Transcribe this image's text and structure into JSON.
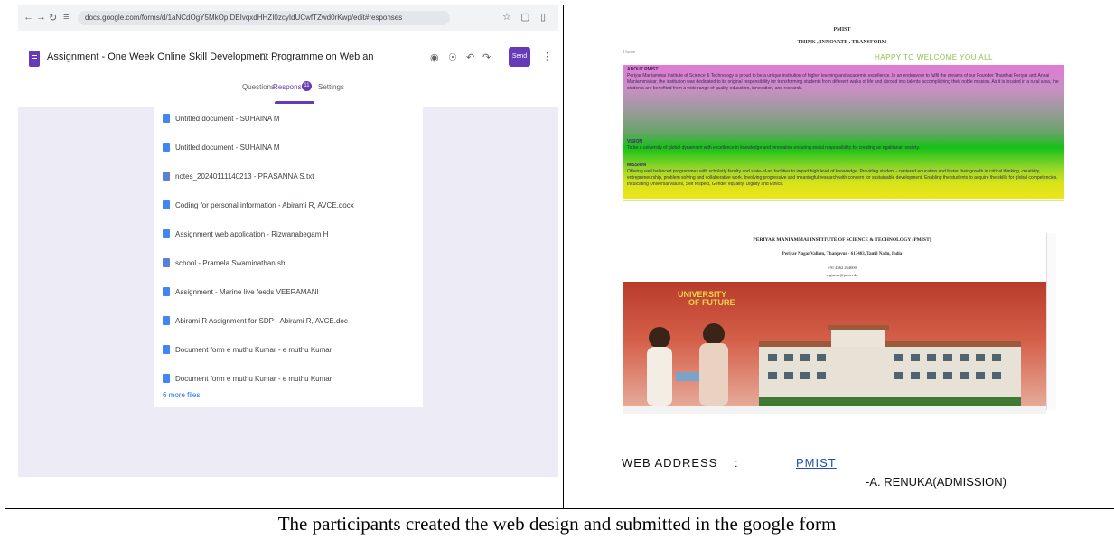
{
  "left_screenshot": {
    "browser": {
      "url": "docs.google.com/forms/d/1aNCdOgY5MkOpIDEIvqxdHHZI0zcyIdUCwfTZwd0rKwp/edit#responses",
      "icons": [
        "back-icon",
        "forward-icon",
        "reload-icon",
        "site-info-icon",
        "star-icon",
        "extensions-icon",
        "menu-icon"
      ]
    },
    "form": {
      "title": "Assignment - One Week Online Skill Development Programme on Web an",
      "send_label": "Send",
      "tabs": [
        "Questions",
        "Responses",
        "Settings"
      ],
      "responses_count": "11",
      "files": [
        {
          "name": "Untitled document - SUHAINA M",
          "icon": "doc"
        },
        {
          "name": "Untitled document - SUHAINA M",
          "icon": "doc"
        },
        {
          "name": "notes_20240111140213 - PRASANNA S.txt",
          "icon": "text"
        },
        {
          "name": "Coding for personal information - Abirami R, AVCE.docx",
          "icon": "doc"
        },
        {
          "name": "Assignment web application - Rizwanabegam H",
          "icon": "doc"
        },
        {
          "name": "school - Pramela Swaminathan.sh",
          "icon": "text"
        },
        {
          "name": "Assignment - Marine live feeds VEERAMANI",
          "icon": "doc"
        },
        {
          "name": "Abirami R Assignment for SDP - Abirami R, AVCE.doc",
          "icon": "doc"
        },
        {
          "name": "Document form e muthu Kumar - e muthu Kumar",
          "icon": "doc"
        },
        {
          "name": "Document form e muthu Kumar - e muthu Kumar",
          "icon": "doc"
        }
      ],
      "more_files": "6 more files"
    }
  },
  "right_screenshot": {
    "site_name": "PMIST",
    "tagline": "THINK , INNOVATE . TRANSFORM",
    "home_link": "Home",
    "welcome": "HAPPY TO WELCOME YOU ALL",
    "sections": [
      {
        "heading": "ABOUT PMIST",
        "text": "Periyar Maniammai Institute of Science & Technology is proud to be a unique institution of higher learning and academic excellence. In an endeavour to fulfil the dreams of our Founder Thanthai Periyar and Annai Maniammaiyar, the institution was dedicated to its original responsibility for transforming students from different walks of life and abroad into talents accomplishing their noble mission. As it is located in a rural area, the students are benefited from a wide range of quality education, innovation, and research."
      },
      {
        "heading": "VISION",
        "text": "To be a university of global dynamism with excellence in knowledge and innovation ensuring social responsibility for creating an egalitarian society."
      },
      {
        "heading": "MISSION",
        "text": "Offering well balanced programmes with scholarly faculty and state-of-art facilities to impart high level of knowledge. Providing student - centered education and foster their growth in critical thinking, creativity, entrepreneurship, problem solving and collaborative work. Involving progressive and meaningful research with concern for sustainable development. Enabling the students to acquire the skills for global competencies. Inculcating Universal values, Self respect, Gender equality, Dignity and Ethics."
      }
    ],
    "institute_name": "PERIYAR MANIAMMAI INSTITUTE OF SCIENCE & TECHNOLOGY (PMIST)",
    "address": "Periyar Nagar,Vallam, Thanjavur - 613403, Tamil Nadu, India",
    "phone": "+91 4362 264600",
    "email": "registrar@pmu.edu",
    "banner_text": [
      "UNIVERSITY",
      "OF FUTURE"
    ],
    "web_address_label": "WEB ADDRESS",
    "separator": ":",
    "web_link": "PMIST",
    "signature": "-A. RENUKA(ADMISSION)"
  },
  "caption": "The participants created the web design and submitted in the google form",
  "colors": {
    "form_accent": "#673ab7",
    "form_background": "#edebf5",
    "welcome_green": "#8bc34a",
    "link_blue": "#1f4fb3"
  }
}
